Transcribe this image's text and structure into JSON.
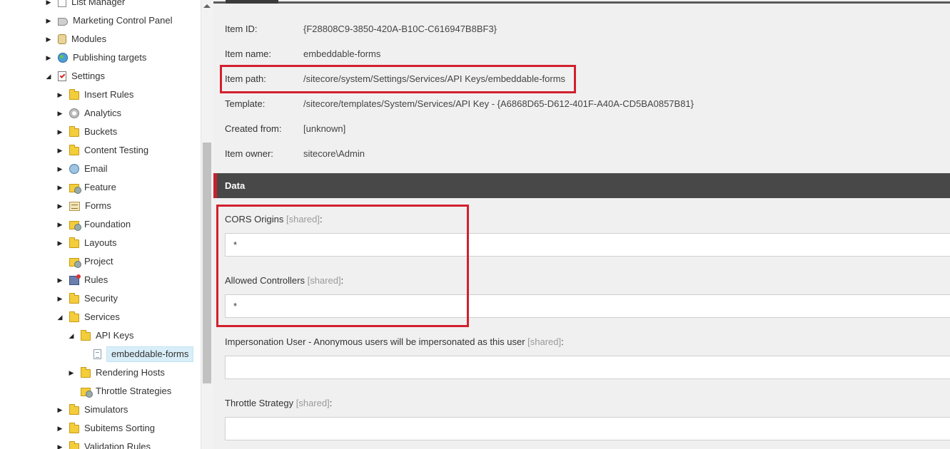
{
  "tree": {
    "items": [
      {
        "label": "List Manager",
        "icon": "list-icon",
        "expanded": false
      },
      {
        "label": "Marketing Control Panel",
        "icon": "megaphone-icon",
        "expanded": false
      },
      {
        "label": "Modules",
        "icon": "jar-icon",
        "expanded": false
      },
      {
        "label": "Publishing targets",
        "icon": "globe-icon",
        "expanded": false
      },
      {
        "label": "Settings",
        "icon": "checklist-icon",
        "expanded": true
      },
      {
        "label": "Insert Rules",
        "icon": "folder-icon",
        "expanded": false
      },
      {
        "label": "Analytics",
        "icon": "gear-icon",
        "expanded": false
      },
      {
        "label": "Buckets",
        "icon": "folder-icon",
        "expanded": false
      },
      {
        "label": "Content Testing",
        "icon": "folder-icon",
        "expanded": false
      },
      {
        "label": "Email",
        "icon": "email-icon",
        "expanded": false
      },
      {
        "label": "Feature",
        "icon": "folder-gear-icon",
        "expanded": false
      },
      {
        "label": "Forms",
        "icon": "forms-icon",
        "expanded": false
      },
      {
        "label": "Foundation",
        "icon": "folder-gear-icon",
        "expanded": false
      },
      {
        "label": "Layouts",
        "icon": "folder-icon",
        "expanded": false
      },
      {
        "label": "Project",
        "icon": "folder-gear-icon",
        "expanded": false
      },
      {
        "label": "Rules",
        "icon": "rules-icon",
        "expanded": false
      },
      {
        "label": "Security",
        "icon": "folder-icon",
        "expanded": false
      },
      {
        "label": "Services",
        "icon": "folder-icon",
        "expanded": true
      },
      {
        "label": "API Keys",
        "icon": "folder-icon",
        "expanded": true
      },
      {
        "label": "embeddable-forms",
        "icon": "page-icon",
        "expanded": false,
        "selected": true
      },
      {
        "label": "Rendering Hosts",
        "icon": "folder-icon",
        "expanded": false
      },
      {
        "label": "Throttle Strategies",
        "icon": "folder-gear-icon",
        "expanded": false
      },
      {
        "label": "Simulators",
        "icon": "folder-icon",
        "expanded": false
      },
      {
        "label": "Subitems Sorting",
        "icon": "folder-icon",
        "expanded": false
      },
      {
        "label": "Validation Rules",
        "icon": "folder-icon",
        "expanded": false
      }
    ]
  },
  "item_info": {
    "id_label": "Item ID:",
    "id_value": "{F28808C9-3850-420A-B10C-C616947B8BF3}",
    "name_label": "Item name:",
    "name_value": "embeddable-forms",
    "path_label": "Item path:",
    "path_value": "/sitecore/system/Settings/Services/API Keys/embeddable-forms",
    "template_label": "Template:",
    "template_value": "/sitecore/templates/System/Services/API Key - {A6868D65-D612-401F-A40A-CD5BA0857B81}",
    "created_label": "Created from:",
    "created_value": "[unknown]",
    "owner_label": "Item owner:",
    "owner_value": "sitecore\\Admin"
  },
  "section": {
    "title": "Data"
  },
  "fields": {
    "shared_tag": "[shared]",
    "cors_label": "CORS Origins",
    "cors_value": "*",
    "controllers_label": "Allowed Controllers",
    "controllers_value": "*",
    "impersonation_label": "Impersonation User - Anonymous users will be impersonated as this user",
    "impersonation_value": "",
    "throttle_label": "Throttle Strategy",
    "throttle_value": ""
  },
  "colors": {
    "highlight": "#d2202e",
    "section_header": "#484848",
    "selected_item": "#d8eef8"
  }
}
